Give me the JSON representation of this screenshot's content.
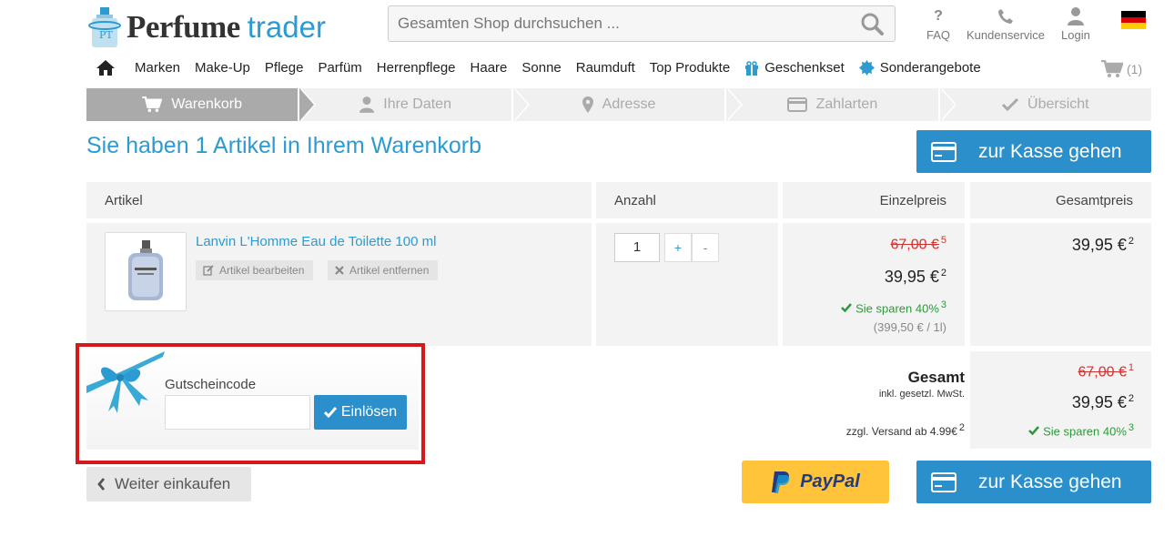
{
  "header": {
    "logo_main": "Perfume",
    "logo_sub": "trader",
    "search_placeholder": "Gesamten Shop durchsuchen ...",
    "links": [
      {
        "label": "FAQ",
        "icon": "question-icon"
      },
      {
        "label": "Kundenservice",
        "icon": "phone-icon"
      },
      {
        "label": "Login",
        "icon": "user-icon"
      }
    ],
    "flag": "germany-flag"
  },
  "nav": {
    "items": [
      "Marken",
      "Make-Up",
      "Pflege",
      "Parfüm",
      "Herrenpflege",
      "Haare",
      "Sonne",
      "Raumduft",
      "Top Produkte",
      "Geschenkset",
      "Sonderangebote"
    ],
    "cart_count": "(1)"
  },
  "steps": [
    "Warenkorb",
    "Ihre Daten",
    "Adresse",
    "Zahlarten",
    "Übersicht"
  ],
  "page_title": "Sie haben 1 Artikel in Ihrem Warenkorb",
  "checkout_label": "zur Kasse gehen",
  "table": {
    "headers": {
      "article": "Artikel",
      "qty": "Anzahl",
      "unit": "Einzelpreis",
      "total": "Gesamtpreis"
    }
  },
  "item": {
    "name": "Lanvin L'Homme Eau de Toilette 100 ml",
    "edit_label": "Artikel bearbeiten",
    "remove_label": "Artikel entfernen",
    "qty": "1",
    "plus": "+",
    "minus": "-",
    "old_price": "67,00 €",
    "old_price_note": "5",
    "price": "39,95 €",
    "price_note": "2",
    "savings": "Sie sparen 40%",
    "savings_note": "3",
    "base_price": "(399,50 € / 1l)",
    "total": "39,95 €",
    "total_note": "2"
  },
  "voucher": {
    "label": "Gutscheincode",
    "button": "Einlösen",
    "value": ""
  },
  "summary": {
    "title": "Gesamt",
    "vat": "inkl. gesetzl. MwSt.",
    "shipping": "zzgl. Versand ab 4.99€",
    "shipping_note": "2",
    "old_total": "67,00 €",
    "old_total_note": "1",
    "total": "39,95 €",
    "total_note": "2",
    "savings": "Sie sparen 40%",
    "savings_note": "3"
  },
  "back_label": "Weiter einkaufen",
  "paypal_label": "PayPal",
  "colors": {
    "accent": "#2b9bd1",
    "button": "#2b8fcb",
    "strike": "#d0332f",
    "save": "#2c9a3a",
    "highlight": "#d6171c",
    "paypal": "#ffc439"
  }
}
